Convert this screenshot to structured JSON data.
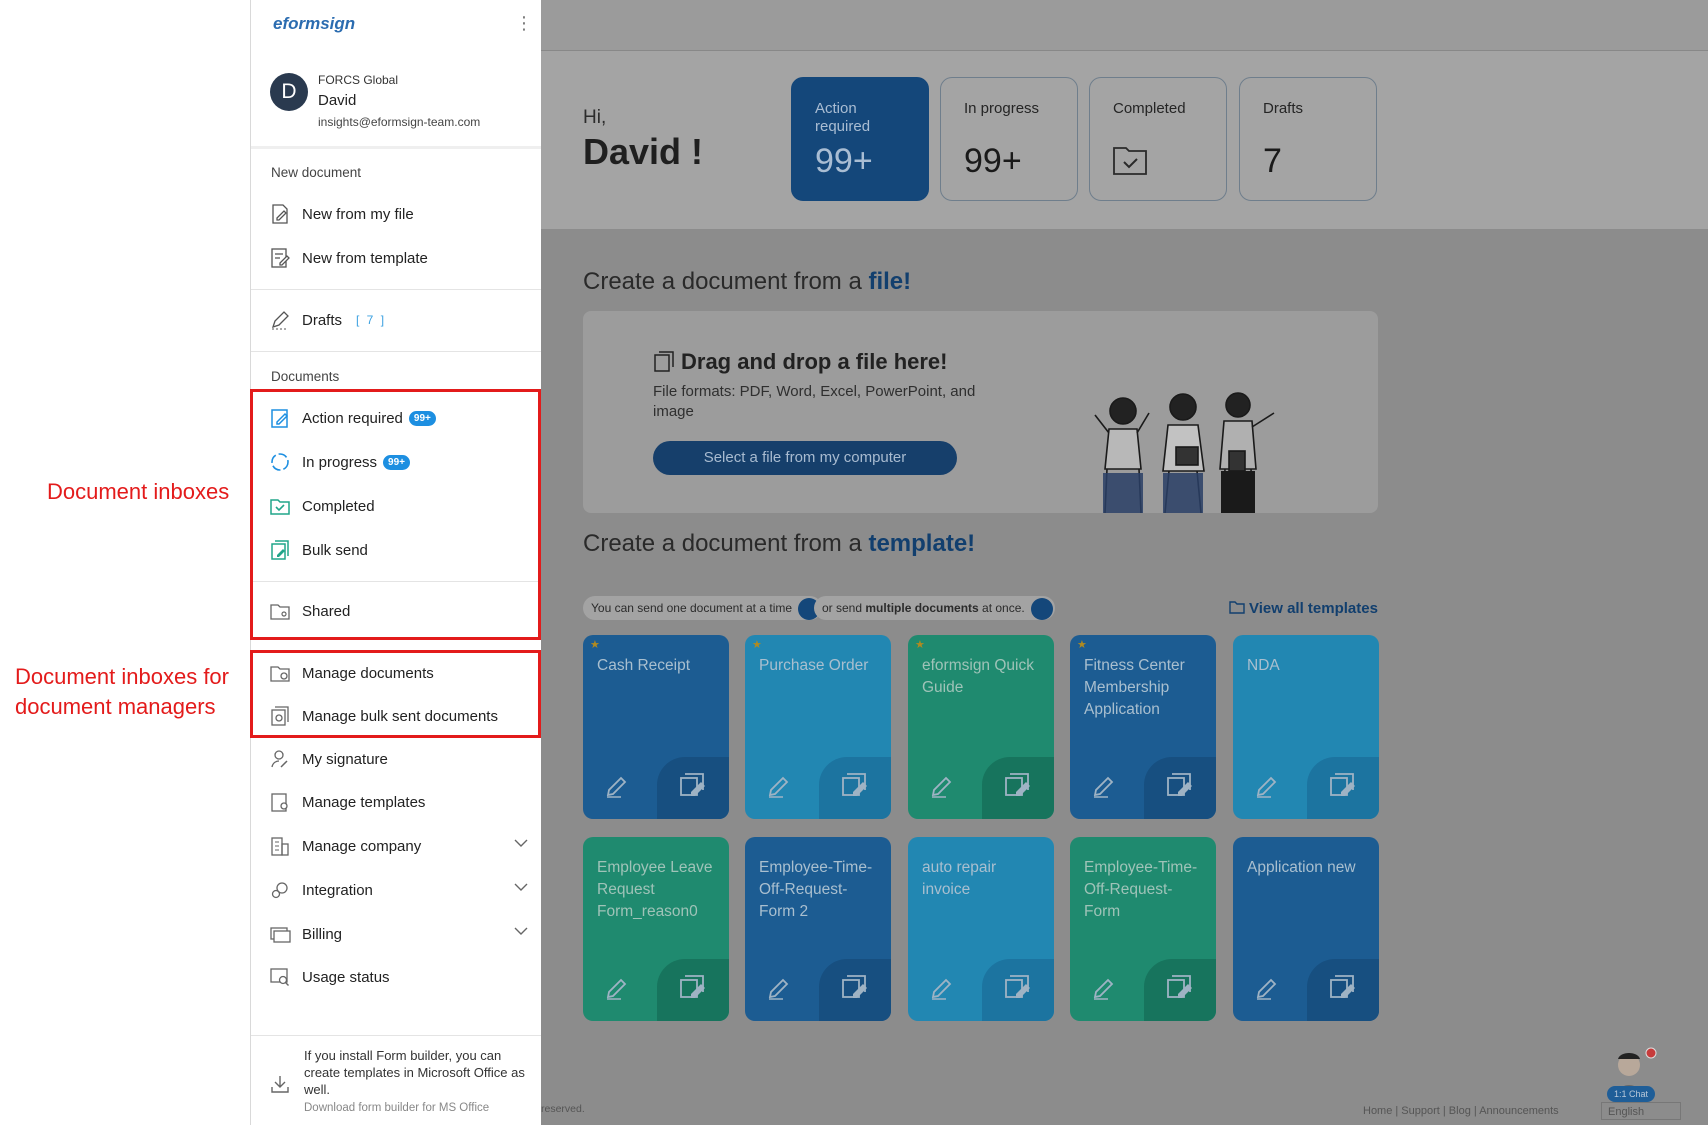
{
  "annotations": {
    "inboxes": "Document inboxes",
    "managers_line1": "Document inboxes for",
    "managers_line2": "document managers"
  },
  "sidebar": {
    "logo": "eformsign",
    "user": {
      "initial": "D",
      "org": "FORCS Global",
      "name": "David",
      "email": "insights@eformsign-team.com"
    },
    "new_document_title": "New document",
    "new_from_file": "New from my file",
    "new_from_template": "New from template",
    "drafts": {
      "label": "Drafts",
      "count": "[ 7 ]"
    },
    "documents_title": "Documents",
    "action_required": {
      "label": "Action required",
      "badge": "99+"
    },
    "in_progress": {
      "label": "In progress",
      "badge": "99+"
    },
    "completed": "Completed",
    "bulk_send": "Bulk send",
    "shared": "Shared",
    "manage_documents": "Manage documents",
    "manage_bulk": "Manage bulk sent documents",
    "my_signature": "My signature",
    "manage_templates": "Manage templates",
    "manage_company": "Manage company",
    "integration": "Integration",
    "billing": "Billing",
    "usage_status": "Usage status",
    "footer_text": "If you install Form builder, you can create templates in Microsoft Office as well.",
    "footer_link": "Download form builder for MS Office"
  },
  "main": {
    "greeting": "Hi,",
    "name": "David !",
    "stats": [
      {
        "label": "Action required",
        "value": "99+"
      },
      {
        "label": "In progress",
        "value": "99+"
      },
      {
        "label": "Completed",
        "value": ""
      },
      {
        "label": "Drafts",
        "value": "7"
      }
    ],
    "file_heading_prefix": "Create a document from a ",
    "file_heading_em": "file!",
    "drop_title": "Drag and drop a file here!",
    "drop_sub": "File formats: PDF, Word, Excel, PowerPoint, and image",
    "select_button": "Select a file from my computer",
    "template_heading_prefix": "Create a document from a ",
    "template_heading_em": "template!",
    "pill_one": "You can send one document at a time",
    "pill_multi_prefix": "or send ",
    "pill_multi_bold": "multiple documents",
    "pill_multi_suffix": " at once.",
    "view_all": "View all templates",
    "templates": [
      {
        "name": "Cash Receipt",
        "color": "blue",
        "star": true
      },
      {
        "name": "Purchase Order",
        "color": "cyan",
        "star": true
      },
      {
        "name": "eformsign Quick Guide",
        "color": "green",
        "star": true
      },
      {
        "name": "Fitness Center Membership Application",
        "color": "blue",
        "star": true
      },
      {
        "name": "NDA",
        "color": "cyan",
        "star": false
      },
      {
        "name": "Employee Leave Request Form_reason0",
        "color": "green",
        "star": false
      },
      {
        "name": "Employee-Time-Off-Request-Form 2",
        "color": "blue",
        "star": false
      },
      {
        "name": "auto repair invoice",
        "color": "cyan",
        "star": false
      },
      {
        "name": "Employee-Time-Off-Request-Form",
        "color": "green",
        "star": false
      },
      {
        "name": "Application new",
        "color": "blue",
        "star": false
      }
    ],
    "footer_left": "reserved.",
    "footer_links": "Home | Support | Blog | Announcements",
    "language": "English",
    "chat_label": "1:1 Chat"
  },
  "colors": {
    "accent": "#1d8fe1",
    "annotation": "#e31b1b",
    "navy": "#14477a"
  }
}
